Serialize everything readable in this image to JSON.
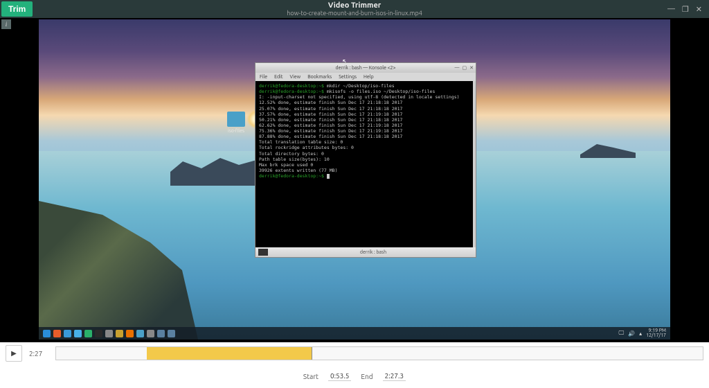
{
  "header": {
    "trim": "Trim",
    "title": "Video Trimmer",
    "file": "how-to-create-mount-and-burn-isos-in-linux.mp4"
  },
  "win": {
    "min": "—",
    "max": "❐",
    "close": "✕"
  },
  "desktop": {
    "iso_folder": "iso-files",
    "clock_time": "9:19 PM",
    "clock_date": "12/17/17",
    "taskbar_icons": [
      "menu",
      "firefox",
      "files",
      "mail",
      "music",
      "steam",
      "term",
      "disc",
      "vlc",
      "folder",
      "trash",
      "win1",
      "win2"
    ]
  },
  "terminal": {
    "title": "derrik : bash — Konsole <2>",
    "menu": [
      "File",
      "Edit",
      "View",
      "Bookmarks",
      "Settings",
      "Help"
    ],
    "footer": "derrik : bash",
    "prompt": "derrik@fedora-desktop:~$",
    "lines": [
      {
        "p": true,
        "t": " mkdir ~/Desktop/iso-files"
      },
      {
        "p": true,
        "t": " mkisofs -o files.iso  ~/Desktop/iso-files"
      },
      {
        "t": "I: -input-charset not specified, using utf-8 (detected in locale settings)"
      },
      {
        "t": "  12.52% done, estimate finish Sun Dec 17 21:18:18 2017"
      },
      {
        "t": "  25.07% done, estimate finish Sun Dec 17 21:18:18 2017"
      },
      {
        "t": "  37.57% done, estimate finish Sun Dec 17 21:19:18 2017"
      },
      {
        "t": "  50.21% done, estimate finish Sun Dec 17 21:18:18 2017"
      },
      {
        "t": "  62.62% done, estimate finish Sun Dec 17 21:19:18 2017"
      },
      {
        "t": "  75.36% done, estimate finish Sun Dec 17 21:19:18 2017"
      },
      {
        "t": "  87.88% done, estimate finish Sun Dec 17 21:18:18 2017"
      },
      {
        "t": "Total translation table size: 0"
      },
      {
        "t": "Total rockridge attributes bytes: 0"
      },
      {
        "t": "Total directory bytes: 0"
      },
      {
        "t": "Path table size(bytes): 10"
      },
      {
        "t": "Max brk space used 0"
      },
      {
        "t": "39926 extents written (77 MB)"
      }
    ]
  },
  "playback": {
    "current": "2:27",
    "start_label": "Start",
    "start": "0:53.5",
    "end_label": "End",
    "end": "2:27.3",
    "sel_left_pct": 14,
    "sel_width_pct": 25.5,
    "head_pct": 39.5
  },
  "tray": {
    "net": "🖵",
    "vol": "🔊",
    "up": "▴"
  }
}
